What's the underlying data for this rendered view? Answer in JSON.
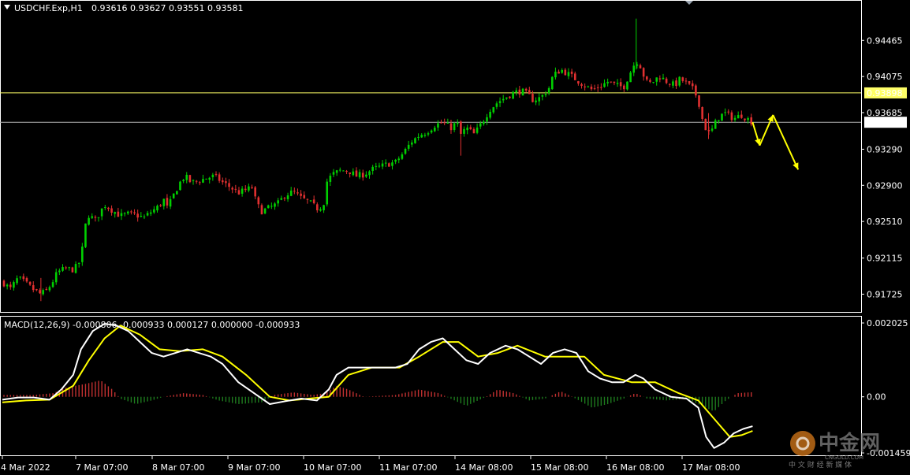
{
  "header": {
    "symbol_label": "USDCHF.Exp,H1",
    "ohlc_text": "0.93616 0.93627 0.93551 0.93581"
  },
  "macd_header": "MACD(12,26,9) -0.000806 -0.000933 0.000127 0.000000 -0.000933",
  "colors": {
    "background": "#000000",
    "bull_candle": "#00d000",
    "bear_candle": "#e03030",
    "level_line": "#ffff66",
    "current_line": "#b0b0b0",
    "macd_main": "#ffffff",
    "macd_signal": "#ffff00",
    "hist_positive": "#c03030",
    "hist_negative": "#1e7a1e",
    "arrow": "#ffff00"
  },
  "price_axis": {
    "ticks": [
      "0.94465",
      "0.94075",
      "0.93685",
      "0.93290",
      "0.92900",
      "0.92510",
      "0.92115",
      "0.91725"
    ],
    "level_label": "0.93898",
    "current_label": "0.93581"
  },
  "macd_axis": {
    "ticks": [
      "0.002025",
      "0.00",
      "-0.001459"
    ]
  },
  "time_axis": {
    "labels": [
      "4 Mar 2022",
      "7 Mar 07:00",
      "8 Mar 07:00",
      "9 Mar 07:00",
      "10 Mar 07:00",
      "11 Mar 07:00",
      "14 Mar 08:00",
      "15 Mar 08:00",
      "16 Mar 08:00",
      "17 Mar 08:00"
    ]
  },
  "chart_data": {
    "type": "candlestick",
    "symbol": "USDCHF.Exp",
    "timeframe": "H1",
    "last_bar": {
      "open": 0.93616,
      "high": 0.93627,
      "low": 0.93551,
      "close": 0.93581
    },
    "ylim": [
      0.9155,
      0.9485
    ],
    "horizontal_levels": [
      0.93898,
      0.93581
    ],
    "close_path": [
      {
        "t": 0,
        "close": 0.9186
      },
      {
        "t": 10,
        "close": 0.9178
      },
      {
        "t": 20,
        "close": 0.919
      },
      {
        "t": 30,
        "close": 0.9184
      },
      {
        "t": 40,
        "close": 0.9177
      },
      {
        "t": 48,
        "close": 0.9173
      },
      {
        "t": 55,
        "close": 0.9175
      },
      {
        "t": 62,
        "close": 0.9183
      },
      {
        "t": 70,
        "close": 0.9196
      },
      {
        "t": 80,
        "close": 0.92
      },
      {
        "t": 90,
        "close": 0.9199
      },
      {
        "t": 95,
        "close": 0.9203
      },
      {
        "t": 100,
        "close": 0.921
      },
      {
        "t": 105,
        "close": 0.9245
      },
      {
        "t": 110,
        "close": 0.9258
      },
      {
        "t": 118,
        "close": 0.9252
      },
      {
        "t": 125,
        "close": 0.9262
      },
      {
        "t": 130,
        "close": 0.9269
      },
      {
        "t": 140,
        "close": 0.9263
      },
      {
        "t": 150,
        "close": 0.9257
      },
      {
        "t": 160,
        "close": 0.9259
      },
      {
        "t": 170,
        "close": 0.9258
      },
      {
        "t": 180,
        "close": 0.9255
      },
      {
        "t": 190,
        "close": 0.9262
      },
      {
        "t": 200,
        "close": 0.9268
      },
      {
        "t": 205,
        "close": 0.9275
      },
      {
        "t": 210,
        "close": 0.9265
      },
      {
        "t": 218,
        "close": 0.928
      },
      {
        "t": 225,
        "close": 0.9292
      },
      {
        "t": 232,
        "close": 0.93
      },
      {
        "t": 240,
        "close": 0.9293
      },
      {
        "t": 250,
        "close": 0.9295
      },
      {
        "t": 260,
        "close": 0.9298
      },
      {
        "t": 270,
        "close": 0.93
      },
      {
        "t": 280,
        "close": 0.9293
      },
      {
        "t": 290,
        "close": 0.9288
      },
      {
        "t": 300,
        "close": 0.9282
      },
      {
        "t": 310,
        "close": 0.9285
      },
      {
        "t": 318,
        "close": 0.9288
      },
      {
        "t": 323,
        "close": 0.927
      },
      {
        "t": 330,
        "close": 0.9262
      },
      {
        "t": 340,
        "close": 0.9266
      },
      {
        "t": 350,
        "close": 0.927
      },
      {
        "t": 360,
        "close": 0.928
      },
      {
        "t": 370,
        "close": 0.9283
      },
      {
        "t": 380,
        "close": 0.9276
      },
      {
        "t": 390,
        "close": 0.9272
      },
      {
        "t": 400,
        "close": 0.9265
      },
      {
        "t": 408,
        "close": 0.9268
      },
      {
        "t": 413,
        "close": 0.9295
      },
      {
        "t": 420,
        "close": 0.9302
      },
      {
        "t": 430,
        "close": 0.9306
      },
      {
        "t": 440,
        "close": 0.9306
      },
      {
        "t": 450,
        "close": 0.93
      },
      {
        "t": 460,
        "close": 0.9302
      },
      {
        "t": 470,
        "close": 0.9307
      },
      {
        "t": 480,
        "close": 0.931
      },
      {
        "t": 490,
        "close": 0.9313
      },
      {
        "t": 500,
        "close": 0.9315
      },
      {
        "t": 510,
        "close": 0.9325
      },
      {
        "t": 520,
        "close": 0.9337
      },
      {
        "t": 530,
        "close": 0.9344
      },
      {
        "t": 540,
        "close": 0.9348
      },
      {
        "t": 550,
        "close": 0.9355
      },
      {
        "t": 560,
        "close": 0.9358
      },
      {
        "t": 570,
        "close": 0.9352
      },
      {
        "t": 578,
        "close": 0.9358
      },
      {
        "t": 583,
        "close": 0.9345
      },
      {
        "t": 590,
        "close": 0.9352
      },
      {
        "t": 600,
        "close": 0.9345
      },
      {
        "t": 610,
        "close": 0.9358
      },
      {
        "t": 620,
        "close": 0.9372
      },
      {
        "t": 630,
        "close": 0.938
      },
      {
        "t": 640,
        "close": 0.9385
      },
      {
        "t": 650,
        "close": 0.939
      },
      {
        "t": 660,
        "close": 0.9392
      },
      {
        "t": 668,
        "close": 0.9388
      },
      {
        "t": 675,
        "close": 0.9382
      },
      {
        "t": 685,
        "close": 0.9385
      },
      {
        "t": 695,
        "close": 0.9395
      },
      {
        "t": 700,
        "close": 0.9408
      },
      {
        "t": 710,
        "close": 0.9415
      },
      {
        "t": 720,
        "close": 0.941
      },
      {
        "t": 730,
        "close": 0.9404
      },
      {
        "t": 740,
        "close": 0.9398
      },
      {
        "t": 750,
        "close": 0.9393
      },
      {
        "t": 760,
        "close": 0.9397
      },
      {
        "t": 770,
        "close": 0.9402
      },
      {
        "t": 780,
        "close": 0.9398
      },
      {
        "t": 790,
        "close": 0.9396
      },
      {
        "t": 800,
        "close": 0.9415
      },
      {
        "t": 806,
        "close": 0.9425
      },
      {
        "t": 812,
        "close": 0.9418
      },
      {
        "t": 818,
        "close": 0.9402
      },
      {
        "t": 825,
        "close": 0.94
      },
      {
        "t": 835,
        "close": 0.9408
      },
      {
        "t": 845,
        "close": 0.9402
      },
      {
        "t": 855,
        "close": 0.9398
      },
      {
        "t": 862,
        "close": 0.9405
      },
      {
        "t": 870,
        "close": 0.94
      },
      {
        "t": 880,
        "close": 0.9392
      },
      {
        "t": 886,
        "close": 0.9378
      },
      {
        "t": 890,
        "close": 0.9362
      },
      {
        "t": 895,
        "close": 0.935
      },
      {
        "t": 900,
        "close": 0.9345
      },
      {
        "t": 905,
        "close": 0.9355
      },
      {
        "t": 912,
        "close": 0.9365
      },
      {
        "t": 920,
        "close": 0.9368
      },
      {
        "t": 930,
        "close": 0.9362
      },
      {
        "t": 940,
        "close": 0.9366
      },
      {
        "t": 947,
        "close": 0.9362
      },
      {
        "t": 954,
        "close": 0.93581
      }
    ],
    "projection_arrows": [
      {
        "from": {
          "t": 954,
          "price": 0.93581
        },
        "to": {
          "t": 963,
          "price": 0.9333
        }
      },
      {
        "from": {
          "t": 963,
          "price": 0.9333
        },
        "to": {
          "t": 980,
          "price": 0.9366
        }
      },
      {
        "from": {
          "t": 980,
          "price": 0.9366
        },
        "to": {
          "t": 1012,
          "price": 0.9307
        }
      }
    ],
    "macd": {
      "params": "12,26,9",
      "values": {
        "main": -0.000806,
        "signal": -0.000933,
        "histogram": 0.000127
      },
      "ylim": [
        -0.00158,
        0.00215
      ],
      "main_points": [
        {
          "t": 0,
          "v": -8e-05
        },
        {
          "t": 20,
          "v": -2e-05
        },
        {
          "t": 40,
          "v": -2e-05
        },
        {
          "t": 60,
          "v": -8e-05
        },
        {
          "t": 75,
          "v": 0.0002
        },
        {
          "t": 90,
          "v": 0.0006
        },
        {
          "t": 100,
          "v": 0.0013
        },
        {
          "t": 115,
          "v": 0.0018
        },
        {
          "t": 130,
          "v": 0.002
        },
        {
          "t": 145,
          "v": 0.00195
        },
        {
          "t": 160,
          "v": 0.0018
        },
        {
          "t": 175,
          "v": 0.0015
        },
        {
          "t": 190,
          "v": 0.0012
        },
        {
          "t": 205,
          "v": 0.0011
        },
        {
          "t": 220,
          "v": 0.0012
        },
        {
          "t": 235,
          "v": 0.0013
        },
        {
          "t": 250,
          "v": 0.0012
        },
        {
          "t": 265,
          "v": 0.0011
        },
        {
          "t": 280,
          "v": 0.0009
        },
        {
          "t": 300,
          "v": 0.0004
        },
        {
          "t": 320,
          "v": 0.0001
        },
        {
          "t": 340,
          "v": -0.0002
        },
        {
          "t": 360,
          "v": -0.00012
        },
        {
          "t": 380,
          "v": -5e-05
        },
        {
          "t": 400,
          "v": -0.0001
        },
        {
          "t": 415,
          "v": 0.0002
        },
        {
          "t": 425,
          "v": 0.0006
        },
        {
          "t": 440,
          "v": 0.0008
        },
        {
          "t": 460,
          "v": 0.0008
        },
        {
          "t": 480,
          "v": 0.0008
        },
        {
          "t": 500,
          "v": 0.0008
        },
        {
          "t": 515,
          "v": 0.0009
        },
        {
          "t": 530,
          "v": 0.0013
        },
        {
          "t": 545,
          "v": 0.0015
        },
        {
          "t": 560,
          "v": 0.0016
        },
        {
          "t": 575,
          "v": 0.0013
        },
        {
          "t": 590,
          "v": 0.001
        },
        {
          "t": 605,
          "v": 0.0009
        },
        {
          "t": 620,
          "v": 0.0012
        },
        {
          "t": 640,
          "v": 0.0014
        },
        {
          "t": 655,
          "v": 0.0013
        },
        {
          "t": 670,
          "v": 0.0011
        },
        {
          "t": 685,
          "v": 0.0009
        },
        {
          "t": 700,
          "v": 0.0012
        },
        {
          "t": 715,
          "v": 0.0013
        },
        {
          "t": 730,
          "v": 0.0012
        },
        {
          "t": 745,
          "v": 0.0007
        },
        {
          "t": 760,
          "v": 0.0005
        },
        {
          "t": 775,
          "v": 0.0004
        },
        {
          "t": 790,
          "v": 0.0004
        },
        {
          "t": 805,
          "v": 0.0006
        },
        {
          "t": 815,
          "v": 0.0005
        },
        {
          "t": 830,
          "v": 0.0002
        },
        {
          "t": 850,
          "v": 0.0
        },
        {
          "t": 870,
          "v": -5e-05
        },
        {
          "t": 885,
          "v": -0.0003
        },
        {
          "t": 895,
          "v": -0.0011
        },
        {
          "t": 905,
          "v": -0.0014
        },
        {
          "t": 918,
          "v": -0.00125
        },
        {
          "t": 930,
          "v": -0.001
        },
        {
          "t": 942,
          "v": -0.00088
        },
        {
          "t": 954,
          "v": -0.000806
        }
      ],
      "signal_points": [
        {
          "t": 0,
          "v": -0.00015
        },
        {
          "t": 30,
          "v": -0.0001
        },
        {
          "t": 60,
          "v": -8e-05
        },
        {
          "t": 90,
          "v": 0.0003
        },
        {
          "t": 110,
          "v": 0.001
        },
        {
          "t": 130,
          "v": 0.0016
        },
        {
          "t": 150,
          "v": 0.00195
        },
        {
          "t": 175,
          "v": 0.0017
        },
        {
          "t": 200,
          "v": 0.0013
        },
        {
          "t": 225,
          "v": 0.00125
        },
        {
          "t": 255,
          "v": 0.0013
        },
        {
          "t": 280,
          "v": 0.0011
        },
        {
          "t": 310,
          "v": 0.0006
        },
        {
          "t": 340,
          "v": 0.0
        },
        {
          "t": 365,
          "v": -0.0001
        },
        {
          "t": 390,
          "v": -5e-05
        },
        {
          "t": 415,
          "v": 0.0
        },
        {
          "t": 440,
          "v": 0.0006
        },
        {
          "t": 470,
          "v": 0.0008
        },
        {
          "t": 505,
          "v": 0.0008
        },
        {
          "t": 530,
          "v": 0.0011
        },
        {
          "t": 560,
          "v": 0.0015
        },
        {
          "t": 580,
          "v": 0.0015
        },
        {
          "t": 605,
          "v": 0.0011
        },
        {
          "t": 630,
          "v": 0.0012
        },
        {
          "t": 655,
          "v": 0.0014
        },
        {
          "t": 690,
          "v": 0.0011
        },
        {
          "t": 715,
          "v": 0.0011
        },
        {
          "t": 740,
          "v": 0.0011
        },
        {
          "t": 765,
          "v": 0.0006
        },
        {
          "t": 800,
          "v": 0.0004
        },
        {
          "t": 830,
          "v": 0.0004
        },
        {
          "t": 860,
          "v": 0.0001
        },
        {
          "t": 885,
          "v": -0.0001
        },
        {
          "t": 905,
          "v": -0.0006
        },
        {
          "t": 925,
          "v": -0.0011
        },
        {
          "t": 940,
          "v": -0.00105
        },
        {
          "t": 954,
          "v": -0.000933
        }
      ],
      "histogram_points": [
        {
          "t": 0,
          "v": 5e-05
        },
        {
          "t": 40,
          "v": 5e-05
        },
        {
          "t": 65,
          "v": 0.0001
        },
        {
          "t": 80,
          "v": 0.00025
        },
        {
          "t": 105,
          "v": 0.00035
        },
        {
          "t": 125,
          "v": 0.00045
        },
        {
          "t": 140,
          "v": 0.0002
        },
        {
          "t": 150,
          "v": -5e-05
        },
        {
          "t": 170,
          "v": -0.0002
        },
        {
          "t": 190,
          "v": -0.0001
        },
        {
          "t": 205,
          "v": 0.0
        },
        {
          "t": 230,
          "v": 0.0001
        },
        {
          "t": 255,
          "v": 5e-05
        },
        {
          "t": 275,
          "v": -0.0001
        },
        {
          "t": 300,
          "v": -0.0002
        },
        {
          "t": 330,
          "v": -0.00015
        },
        {
          "t": 345,
          "v": 5e-05
        },
        {
          "t": 370,
          "v": 0.00012
        },
        {
          "t": 395,
          "v": 5e-05
        },
        {
          "t": 410,
          "v": 0.0001
        },
        {
          "t": 425,
          "v": 0.0003
        },
        {
          "t": 440,
          "v": 0.0002
        },
        {
          "t": 460,
          "v": 0.0
        },
        {
          "t": 500,
          "v": 5e-05
        },
        {
          "t": 530,
          "v": 0.0002
        },
        {
          "t": 555,
          "v": 0.0001
        },
        {
          "t": 570,
          "v": -5e-05
        },
        {
          "t": 590,
          "v": -0.00025
        },
        {
          "t": 615,
          "v": 0.0
        },
        {
          "t": 630,
          "v": 0.0002
        },
        {
          "t": 650,
          "v": 0.0001
        },
        {
          "t": 670,
          "v": -0.0001
        },
        {
          "t": 690,
          "v": -5e-05
        },
        {
          "t": 710,
          "v": 0.00015
        },
        {
          "t": 725,
          "v": 0.0
        },
        {
          "t": 750,
          "v": -0.0003
        },
        {
          "t": 770,
          "v": -0.0002
        },
        {
          "t": 790,
          "v": -5e-05
        },
        {
          "t": 805,
          "v": 0.0001
        },
        {
          "t": 820,
          "v": -5e-05
        },
        {
          "t": 845,
          "v": -0.0001
        },
        {
          "t": 870,
          "v": -5e-05
        },
        {
          "t": 890,
          "v": -0.00025
        },
        {
          "t": 905,
          "v": -0.0004
        },
        {
          "t": 920,
          "v": -0.0001
        },
        {
          "t": 935,
          "v": 0.0001
        },
        {
          "t": 954,
          "v": 0.000127
        }
      ]
    }
  },
  "watermark": {
    "brand": "中金网",
    "domain": "CNGOLD.COM",
    "tagline": "中 文 财 经 新 媒 体"
  }
}
